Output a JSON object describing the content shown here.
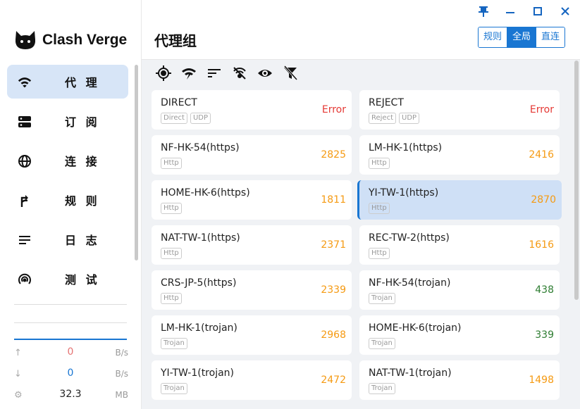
{
  "app": {
    "name": "Clash Verge"
  },
  "nav": {
    "items": [
      {
        "label": "代 理",
        "icon": "wifi-icon",
        "active": true
      },
      {
        "label": "订 阅",
        "icon": "server-icon",
        "active": false
      },
      {
        "label": "连 接",
        "icon": "globe-icon",
        "active": false
      },
      {
        "label": "规 则",
        "icon": "fork-arrow-icon",
        "active": false
      },
      {
        "label": "日 志",
        "icon": "list-lines-icon",
        "active": false
      },
      {
        "label": "测 试",
        "icon": "radar-icon",
        "active": false
      }
    ]
  },
  "traffic": {
    "up_value": "0",
    "up_unit": "B/s",
    "down_value": "0",
    "down_unit": "B/s",
    "mem_value": "32.3",
    "mem_unit": "MB"
  },
  "header": {
    "title": "代理组",
    "modes": [
      {
        "label": "规则",
        "active": false
      },
      {
        "label": "全局",
        "active": true
      },
      {
        "label": "直连",
        "active": false
      }
    ]
  },
  "window": {
    "pin": "pin-icon",
    "minimize": "minimize-icon",
    "maximize": "maximize-icon",
    "close": "close-icon"
  },
  "toolbar": [
    "locate-icon",
    "delay-test-icon",
    "sort-icon",
    "filter-off-icon",
    "eye-icon",
    "filter-clear-icon"
  ],
  "colors": {
    "accent": "#1976d2",
    "error": "#e53935",
    "warn": "#f59a12",
    "good": "#2e7d32"
  },
  "proxies": [
    {
      "name": "DIRECT",
      "tags": [
        "Direct",
        "UDP"
      ],
      "delay": "Error",
      "status": "error"
    },
    {
      "name": "REJECT",
      "tags": [
        "Reject",
        "UDP"
      ],
      "delay": "Error",
      "status": "error"
    },
    {
      "name": "NF-HK-54(https)",
      "tags": [
        "Http"
      ],
      "delay": "2825",
      "status": "warn"
    },
    {
      "name": "LM-HK-1(https)",
      "tags": [
        "Http"
      ],
      "delay": "2416",
      "status": "warn"
    },
    {
      "name": "HOME-HK-6(https)",
      "tags": [
        "Http"
      ],
      "delay": "1811",
      "status": "warn"
    },
    {
      "name": "YI-TW-1(https)",
      "tags": [
        "Http"
      ],
      "delay": "2870",
      "status": "warn",
      "selected": true
    },
    {
      "name": "NAT-TW-1(https)",
      "tags": [
        "Http"
      ],
      "delay": "2371",
      "status": "warn"
    },
    {
      "name": "REC-TW-2(https)",
      "tags": [
        "Http"
      ],
      "delay": "1616",
      "status": "warn"
    },
    {
      "name": "CRS-JP-5(https)",
      "tags": [
        "Http"
      ],
      "delay": "2339",
      "status": "warn"
    },
    {
      "name": "NF-HK-54(trojan)",
      "tags": [
        "Trojan"
      ],
      "delay": "438",
      "status": "good"
    },
    {
      "name": "LM-HK-1(trojan)",
      "tags": [
        "Trojan"
      ],
      "delay": "2968",
      "status": "warn"
    },
    {
      "name": "HOME-HK-6(trojan)",
      "tags": [
        "Trojan"
      ],
      "delay": "339",
      "status": "good"
    },
    {
      "name": "YI-TW-1(trojan)",
      "tags": [
        "Trojan"
      ],
      "delay": "2472",
      "status": "warn"
    },
    {
      "name": "NAT-TW-1(trojan)",
      "tags": [
        "Trojan"
      ],
      "delay": "1498",
      "status": "warn"
    }
  ]
}
